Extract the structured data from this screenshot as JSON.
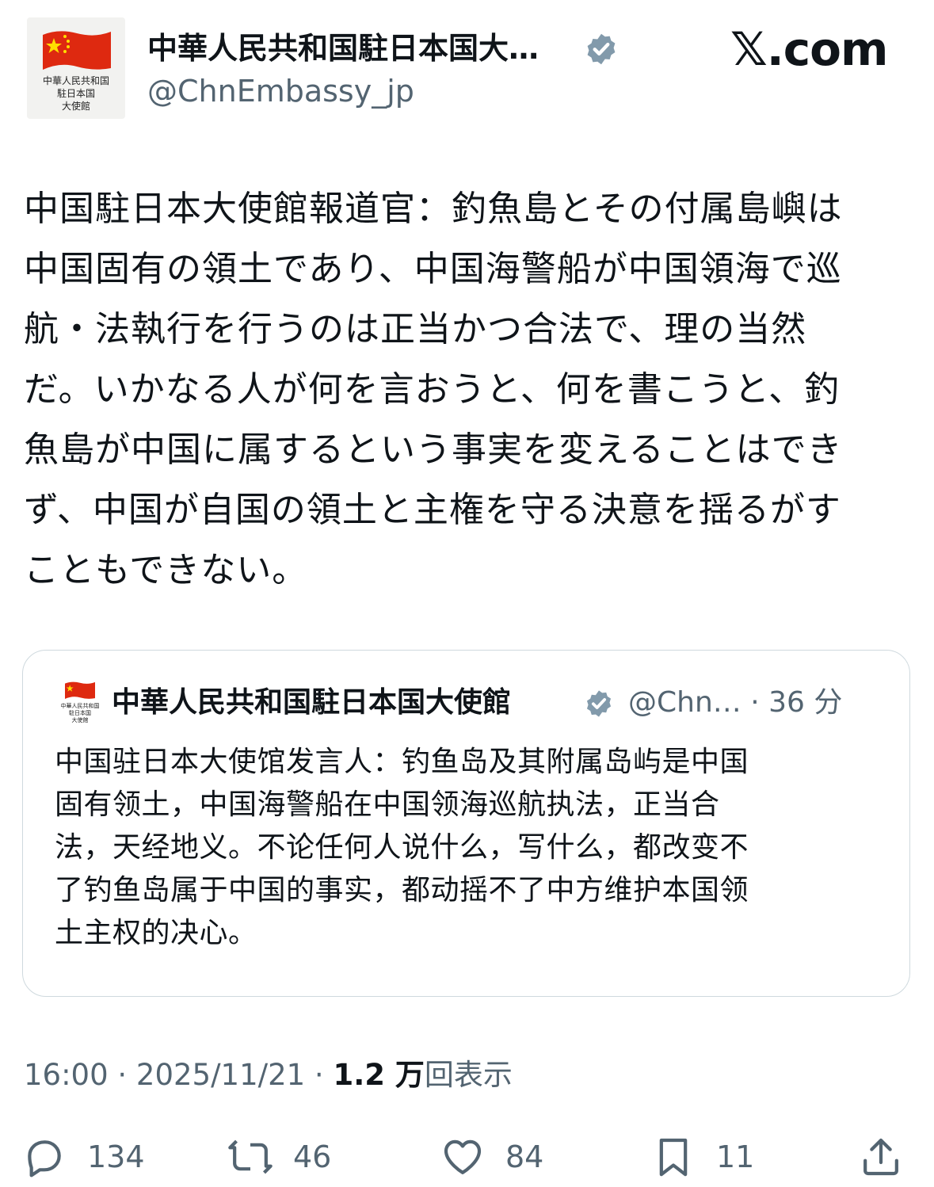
{
  "header": {
    "avatar_text": [
      "中華人民共和国",
      "駐日本国",
      "大使館"
    ],
    "display_name": "中華人民共和国駐日本国大…",
    "handle": "@ChnEmbassy_jp",
    "site_logo": "𝕏.com",
    "flag_colors": {
      "red": "#de2910",
      "yellow": "#ffde00"
    }
  },
  "tweet": {
    "lines": [
      "中国駐日本大使館報道官：釣魚島とその付属島嶼は",
      "中国固有の領土であり、中国海警船が中国領海で巡",
      "航・法執行を行うのは正当かつ合法で、理の当然",
      "だ。いかなる人が何を言おうと、何を書こうと、釣",
      "魚島が中国に属するという事実を変えることはでき",
      "ず、中国が自国の領土と主権を守る決意を揺るがす",
      "こともできない。"
    ]
  },
  "quote": {
    "display_name": "中華人民共和国駐日本国大使館",
    "meta": "@Chn… · 36 分",
    "lines": [
      "中国驻日本大使馆发言人：钓鱼岛及其附属岛屿是中国",
      "固有领土，中国海警船在中国领海巡航执法，正当合",
      "法，天经地义。不论任何人说什么，写什么，都改变不",
      "了钓鱼岛属于中国的事实，都动摇不了中方维护本国领",
      "土主权的决心。"
    ]
  },
  "footer": {
    "time_date": "16:00 · 2025/11/21 · ",
    "views_count": "1.2 万",
    "views_label": "回表示"
  },
  "actions": {
    "reply": {
      "icon": "reply-icon",
      "count": "134"
    },
    "retweet": {
      "icon": "retweet-icon",
      "count": "46"
    },
    "like": {
      "icon": "like-icon",
      "count": "84"
    },
    "bookmark": {
      "icon": "bookmark-icon",
      "count": "11"
    },
    "share": {
      "icon": "share-icon"
    }
  },
  "colors": {
    "text": "#0f1419",
    "secondary": "#536471",
    "verified": "#829aab",
    "border": "#cfd9de"
  }
}
